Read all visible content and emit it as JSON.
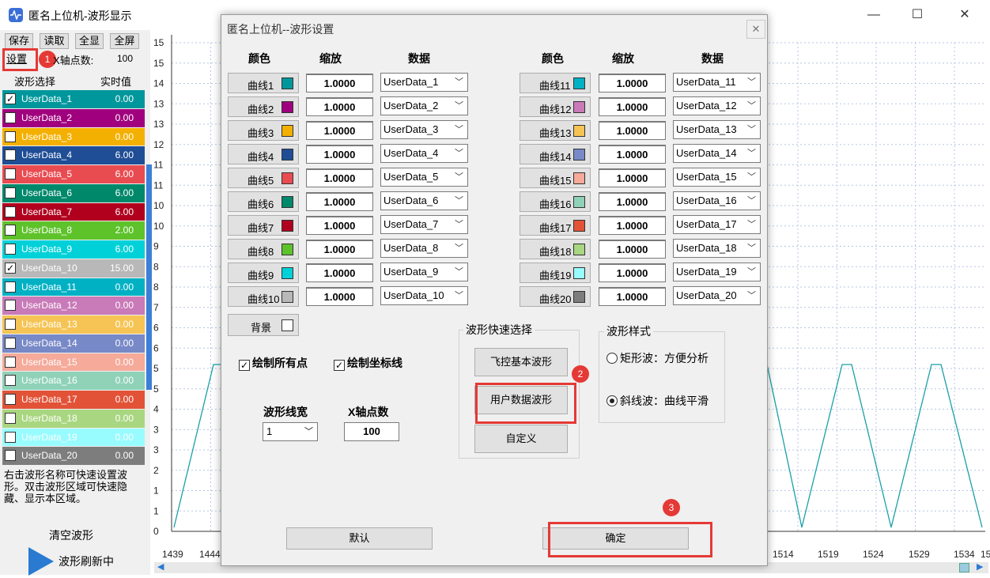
{
  "window": {
    "title": "匿名上位机-波形显示",
    "minimize": "—",
    "maximize": "☐",
    "close": "✕"
  },
  "toolbar": {
    "save": "保存",
    "read": "读取",
    "show_all": "全显",
    "fullscreen": "全屏",
    "settings": "设置"
  },
  "xaxis_points": {
    "label": "X轴点数:",
    "value": "100"
  },
  "list_headers": {
    "wave_select": "波形选择",
    "realtime": "实时值"
  },
  "waves": [
    {
      "name": "UserData_1",
      "value": "0.00",
      "color": "#00979c",
      "checked": true
    },
    {
      "name": "UserData_2",
      "value": "0.00",
      "color": "#a0007e",
      "checked": false
    },
    {
      "name": "UserData_3",
      "value": "0.00",
      "color": "#f4b000",
      "checked": false
    },
    {
      "name": "UserData_4",
      "value": "6.00",
      "color": "#1f4e96",
      "checked": false
    },
    {
      "name": "UserData_5",
      "value": "6.00",
      "color": "#e84c51",
      "checked": false
    },
    {
      "name": "UserData_6",
      "value": "6.00",
      "color": "#00886b",
      "checked": false
    },
    {
      "name": "UserData_7",
      "value": "6.00",
      "color": "#b0001e",
      "checked": false
    },
    {
      "name": "UserData_8",
      "value": "2.00",
      "color": "#5ec22b",
      "checked": false
    },
    {
      "name": "UserData_9",
      "value": "6.00",
      "color": "#00d1d8",
      "checked": false
    },
    {
      "name": "UserData_10",
      "value": "15.00",
      "color": "#b8b8b8",
      "checked": true
    },
    {
      "name": "UserData_11",
      "value": "0.00",
      "color": "#00b1c4",
      "checked": false
    },
    {
      "name": "UserData_12",
      "value": "0.00",
      "color": "#c97ab8",
      "checked": false
    },
    {
      "name": "UserData_13",
      "value": "0.00",
      "color": "#f5c454",
      "checked": false
    },
    {
      "name": "UserData_14",
      "value": "0.00",
      "color": "#7889c7",
      "checked": false
    },
    {
      "name": "UserData_15",
      "value": "0.00",
      "color": "#f5aa9a",
      "checked": false
    },
    {
      "name": "UserData_16",
      "value": "0.00",
      "color": "#8fd2b8",
      "checked": false
    },
    {
      "name": "UserData_17",
      "value": "0.00",
      "color": "#e25237",
      "checked": false
    },
    {
      "name": "UserData_18",
      "value": "0.00",
      "color": "#a9d680",
      "checked": false
    },
    {
      "name": "UserData_19",
      "value": "0.00",
      "color": "#98fcff",
      "checked": false
    },
    {
      "name": "UserData_20",
      "value": "0.00",
      "color": "#7d7d7d",
      "checked": false
    }
  ],
  "hint": "右击波形名称可快速设置波形。双击波形区域可快速隐藏、显示本区域。",
  "clear_label": "清空波形",
  "refresh_label": "波形刷新中",
  "badges": [
    "1",
    "2",
    "3"
  ],
  "chart": {
    "y_ticks": [
      "15",
      "15",
      "14",
      "13",
      "13",
      "12",
      "11",
      "11",
      "10",
      "10",
      "9",
      "8",
      "8",
      "7",
      "6",
      "6",
      "5",
      "5",
      "4",
      "3",
      "3",
      "2",
      "1",
      "1",
      "0"
    ],
    "x_ticks_left": [
      "1439",
      "1444"
    ],
    "x_ticks_right": [
      "1514",
      "1519",
      "1524",
      "1529",
      "1534",
      "15"
    ],
    "line_color": "#1aa0a8"
  },
  "dialog": {
    "title": "匿名上位机--波形设置",
    "close": "✕",
    "headers": {
      "color": "颜色",
      "scale": "缩放",
      "data": "数据"
    },
    "curves": [
      {
        "label": "曲线1",
        "color": "#00979c",
        "scale": "1.0000",
        "data": "UserData_1"
      },
      {
        "label": "曲线2",
        "color": "#a0007e",
        "scale": "1.0000",
        "data": "UserData_2"
      },
      {
        "label": "曲线3",
        "color": "#f4b000",
        "scale": "1.0000",
        "data": "UserData_3"
      },
      {
        "label": "曲线4",
        "color": "#1f4e96",
        "scale": "1.0000",
        "data": "UserData_4"
      },
      {
        "label": "曲线5",
        "color": "#e84c51",
        "scale": "1.0000",
        "data": "UserData_5"
      },
      {
        "label": "曲线6",
        "color": "#00886b",
        "scale": "1.0000",
        "data": "UserData_6"
      },
      {
        "label": "曲线7",
        "color": "#b0001e",
        "scale": "1.0000",
        "data": "UserData_7"
      },
      {
        "label": "曲线8",
        "color": "#5ec22b",
        "scale": "1.0000",
        "data": "UserData_8"
      },
      {
        "label": "曲线9",
        "color": "#00d1d8",
        "scale": "1.0000",
        "data": "UserData_9"
      },
      {
        "label": "曲线10",
        "color": "#b8b8b8",
        "scale": "1.0000",
        "data": "UserData_10"
      },
      {
        "label": "曲线11",
        "color": "#00b1c4",
        "scale": "1.0000",
        "data": "UserData_11"
      },
      {
        "label": "曲线12",
        "color": "#c97ab8",
        "scale": "1.0000",
        "data": "UserData_12"
      },
      {
        "label": "曲线13",
        "color": "#f5c454",
        "scale": "1.0000",
        "data": "UserData_13"
      },
      {
        "label": "曲线14",
        "color": "#7889c7",
        "scale": "1.0000",
        "data": "UserData_14"
      },
      {
        "label": "曲线15",
        "color": "#f5aa9a",
        "scale": "1.0000",
        "data": "UserData_15"
      },
      {
        "label": "曲线16",
        "color": "#8fd2b8",
        "scale": "1.0000",
        "data": "UserData_16"
      },
      {
        "label": "曲线17",
        "color": "#e25237",
        "scale": "1.0000",
        "data": "UserData_17"
      },
      {
        "label": "曲线18",
        "color": "#a9d680",
        "scale": "1.0000",
        "data": "UserData_18"
      },
      {
        "label": "曲线19",
        "color": "#98fcff",
        "scale": "1.0000",
        "data": "UserData_19"
      },
      {
        "label": "曲线20",
        "color": "#7d7d7d",
        "scale": "1.0000",
        "data": "UserData_20"
      }
    ],
    "background": "背景",
    "draw_all_points": "绘制所有点",
    "draw_axes": "绘制坐标线",
    "line_width_label": "波形线宽",
    "line_width_value": "1",
    "x_points_label": "X轴点数",
    "x_points_value": "100",
    "quick_select": {
      "title": "波形快速选择",
      "flight": "飞控基本波形",
      "user": "用户数据波形",
      "custom": "自定义"
    },
    "wave_style": {
      "title": "波形样式",
      "rect": "矩形波：方便分析",
      "slope": "斜线波：曲线平滑",
      "selected": "slope"
    },
    "default_btn": "默认",
    "ok_btn": "确定"
  }
}
